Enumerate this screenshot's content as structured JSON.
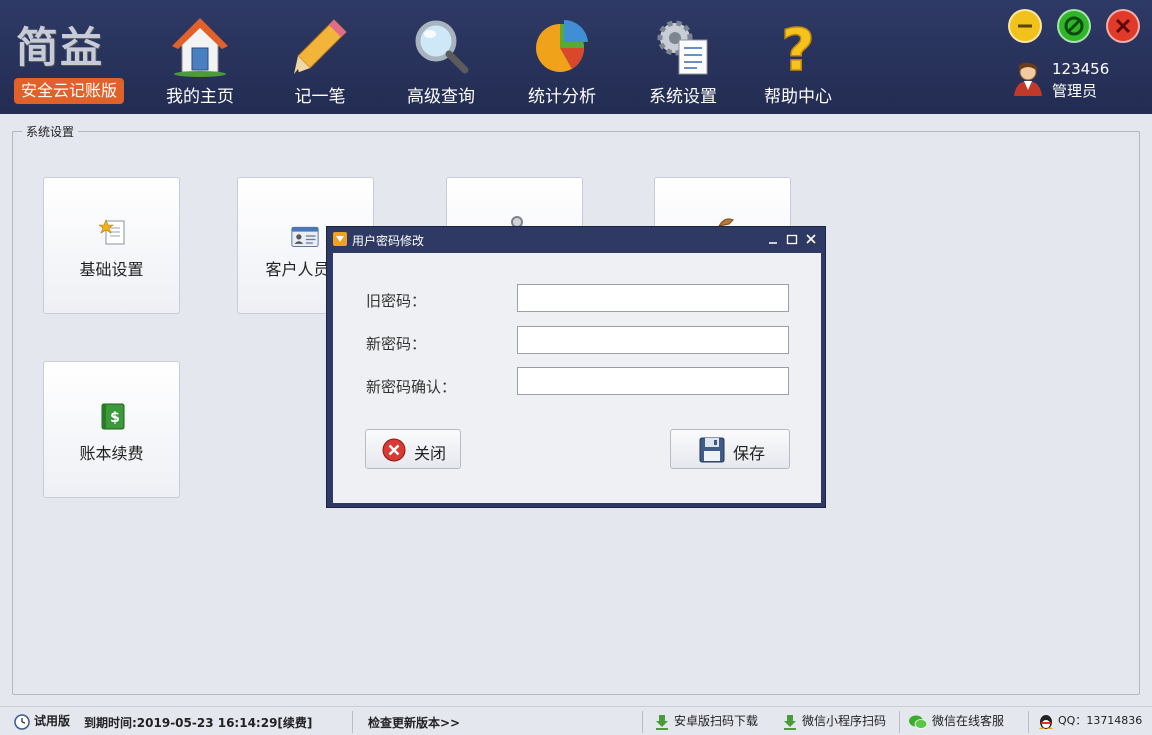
{
  "header": {
    "logo_main": "简益",
    "logo_sub": "安全云记账版",
    "nav": [
      {
        "label": "我的主页",
        "icon": "home-icon"
      },
      {
        "label": "记一笔",
        "icon": "pencil-icon"
      },
      {
        "label": "高级查询",
        "icon": "magnifier-icon"
      },
      {
        "label": "统计分析",
        "icon": "pie-chart-icon"
      },
      {
        "label": "系统设置",
        "icon": "gear-document-icon"
      },
      {
        "label": "帮助中心",
        "icon": "question-mark-icon"
      }
    ],
    "user": {
      "id": "123456",
      "role": "管理员"
    }
  },
  "group": {
    "title": "系统设置",
    "tiles": [
      {
        "label": "基础设置",
        "icon": "settings-document-icon"
      },
      {
        "label": "客户人员设",
        "icon": "contact-card-icon"
      },
      {
        "label": "",
        "icon": "key-icon"
      },
      {
        "label": "",
        "icon": "tool-icon"
      },
      {
        "label": "账本续费",
        "icon": "money-book-icon"
      }
    ]
  },
  "dialog": {
    "title": "用户密码修改",
    "fields": [
      {
        "label": "旧密码：",
        "value": ""
      },
      {
        "label": "新密码：",
        "value": ""
      },
      {
        "label": "新密码确认：",
        "value": ""
      }
    ],
    "close_label": "关闭",
    "save_label": "保存"
  },
  "statusbar": {
    "trial": "试用版",
    "expiry": "到期时间:2019-05-23 16:14:29[续费]",
    "check_update": "检查更新版本>>",
    "android": "安卓版扫码下载",
    "wechat_mini": "微信小程序扫码",
    "wechat_service": "微信在线客服",
    "qq": "QQ：13714836"
  },
  "colors": {
    "header_bg": "#2a3560",
    "logo_sub_bg": "#e0612a",
    "minimize": "#f1c21b",
    "maximize": "#2fb52b",
    "close": "#e23a2a",
    "dialog_frame": "#2f3a64"
  }
}
